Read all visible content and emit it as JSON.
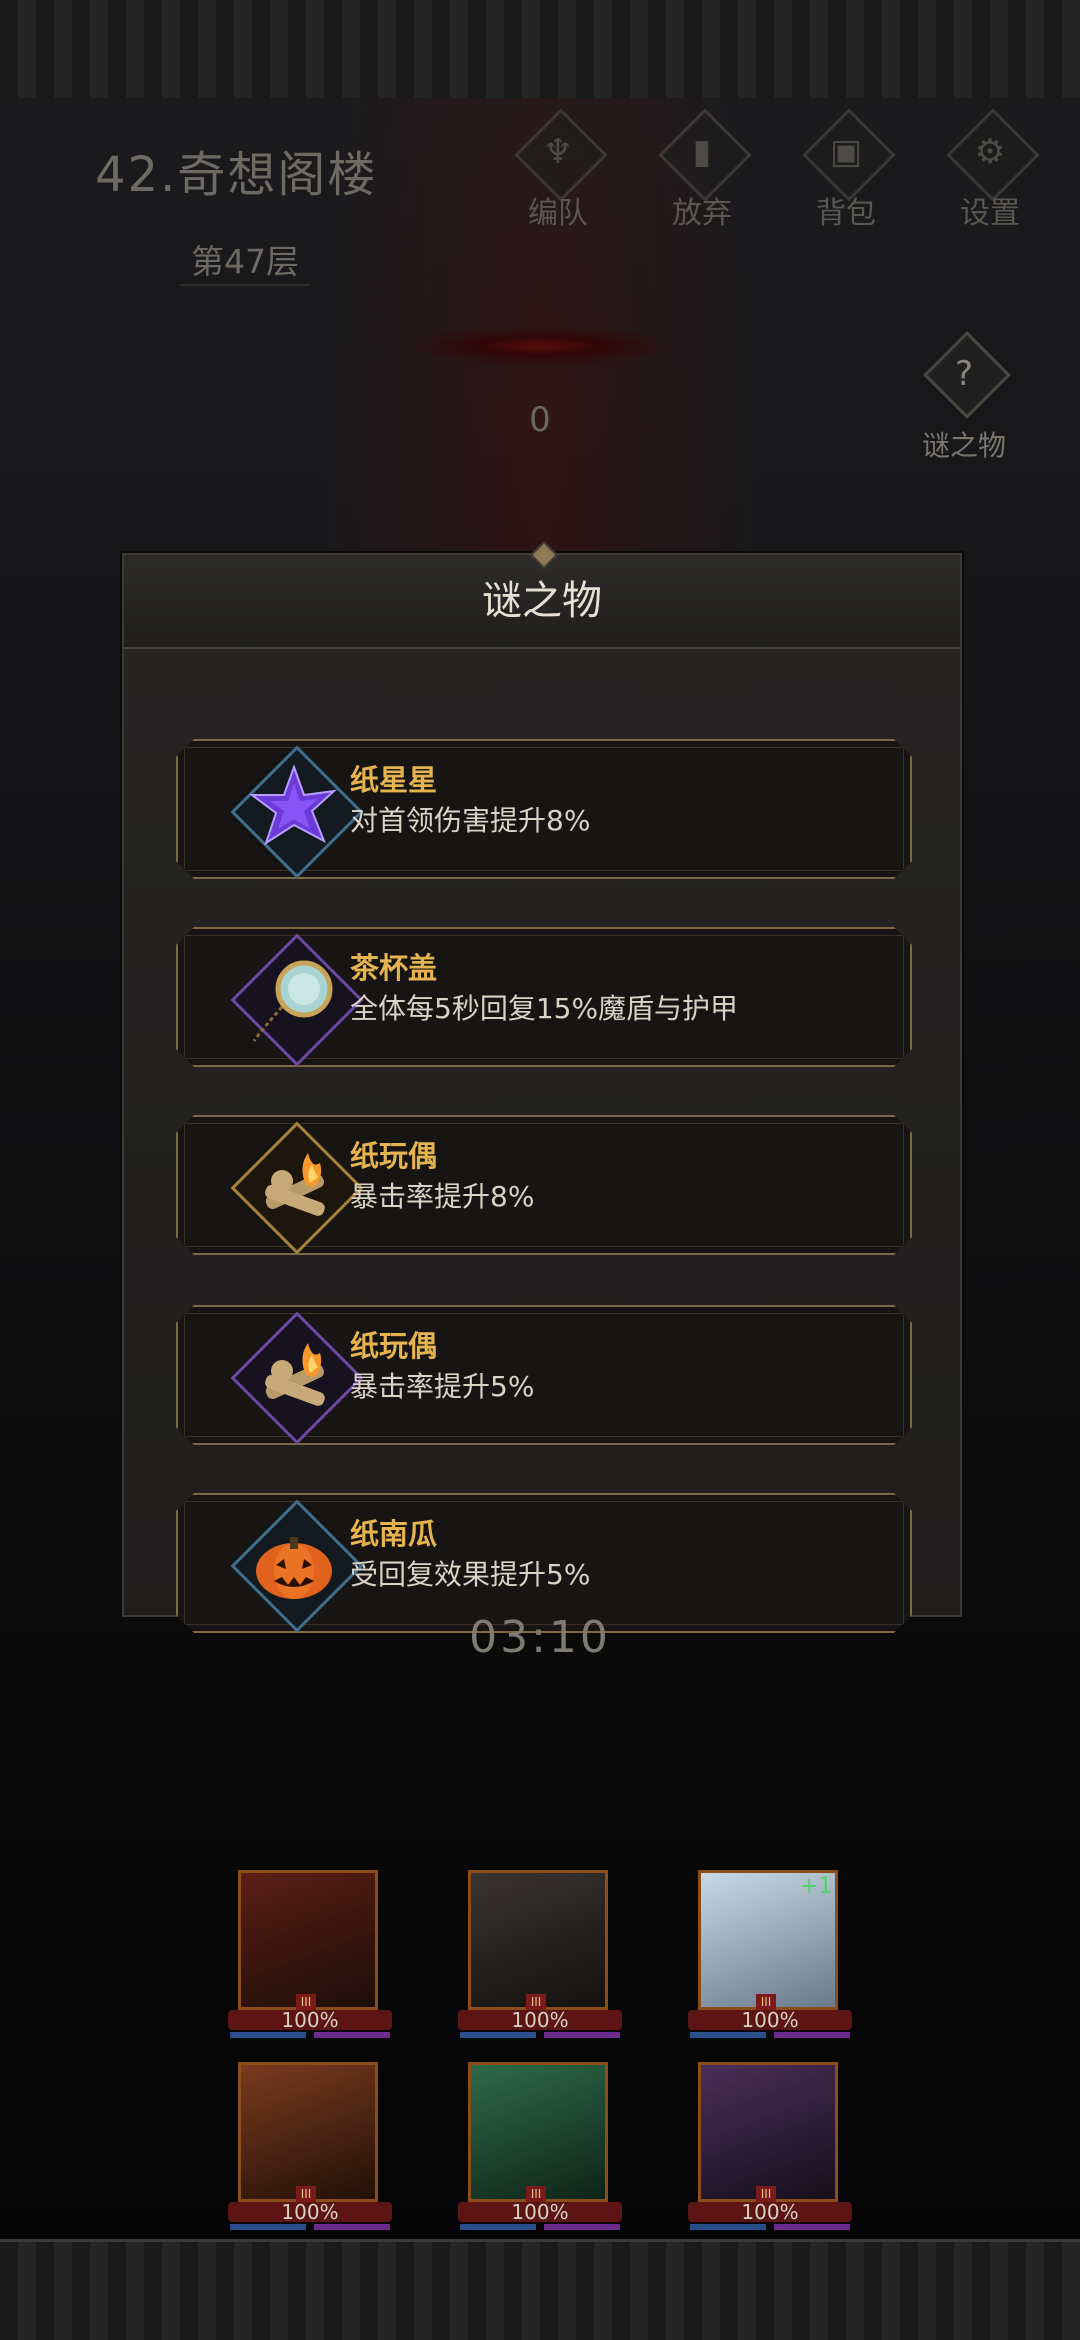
{
  "header": {
    "level_title": "42.奇想阁楼",
    "floor": "第47层",
    "score": "0",
    "buttons": [
      {
        "label": "编队",
        "icon": "demon-helmet-icon"
      },
      {
        "label": "放弃",
        "icon": "exit-door-icon"
      },
      {
        "label": "背包",
        "icon": "backpack-icon"
      },
      {
        "label": "设置",
        "icon": "gear-icon"
      }
    ],
    "mystery_label": "谜之物"
  },
  "modal": {
    "title": "谜之物",
    "items": [
      {
        "name": "纸星星",
        "desc": "对首领伤害提升8%",
        "icon": "paper-star-icon",
        "frame": "blue"
      },
      {
        "name": "茶杯盖",
        "desc": "全体每5秒回复15%魔盾与护甲",
        "icon": "teacup-lid-icon",
        "frame": "purple"
      },
      {
        "name": "纸玩偶",
        "desc": "暴击率提升8%",
        "icon": "burning-doll-icon",
        "frame": "gold"
      },
      {
        "name": "纸玩偶",
        "desc": "暴击率提升5%",
        "icon": "burning-doll-icon",
        "frame": "purple"
      },
      {
        "name": "纸南瓜",
        "desc": "受回复效果提升5%",
        "icon": "pumpkin-icon",
        "frame": "blue"
      }
    ]
  },
  "timer": "03:10",
  "heroes": [
    {
      "hp": "100%",
      "rank": "III"
    },
    {
      "hp": "100%",
      "rank": "III"
    },
    {
      "hp": "100%",
      "rank": "III",
      "badge": "+1"
    },
    {
      "hp": "100%",
      "rank": "III"
    },
    {
      "hp": "100%",
      "rank": "III"
    },
    {
      "hp": "100%",
      "rank": "III"
    }
  ]
}
